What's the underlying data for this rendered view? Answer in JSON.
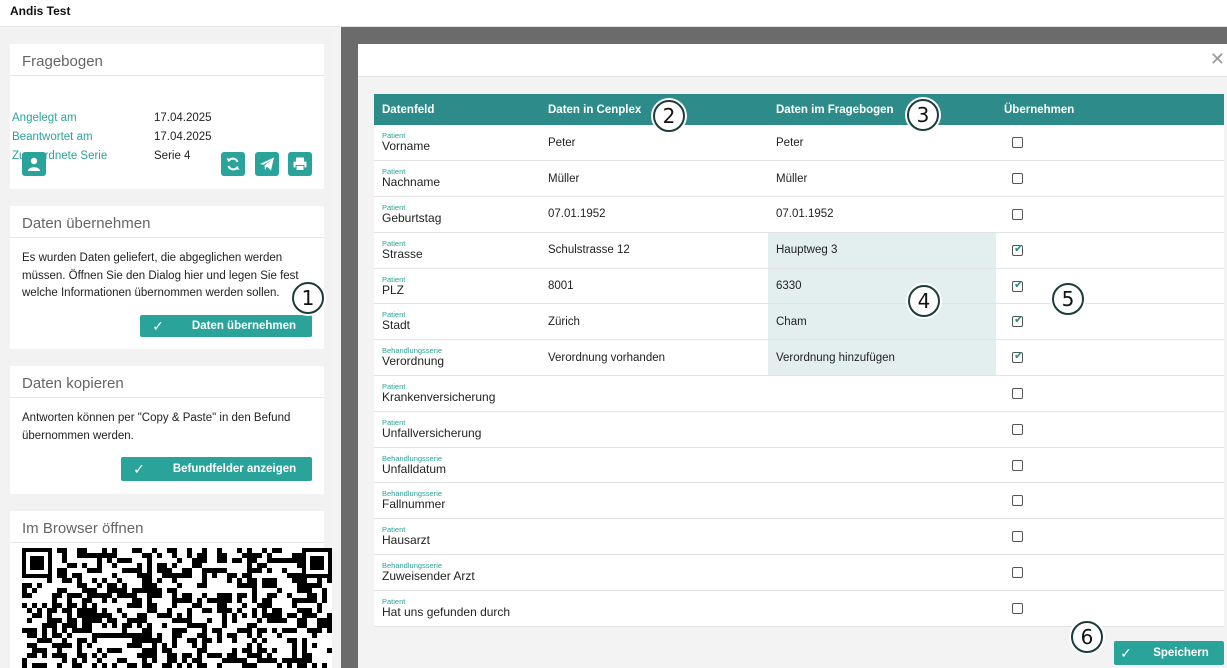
{
  "app": {
    "title": "Andis Test"
  },
  "fragebogen": {
    "title": "Fragebogen",
    "rows": [
      {
        "label": "Angelegt am",
        "value": "17.04.2025"
      },
      {
        "label": "Beantwortet am",
        "value": "17.04.2025"
      },
      {
        "label": "Zugeordnete Serie",
        "value": "Serie 4"
      }
    ],
    "icons": [
      "user-icon",
      "refresh-icon",
      "send-icon",
      "print-icon"
    ]
  },
  "daten_uebernehmen": {
    "title": "Daten übernehmen",
    "text": "Es wurden Daten geliefert, die abgeglichen werden müssen. Öffnen Sie den Dialog hier und legen Sie fest welche Informationen übernommen werden sollen.",
    "button": "Daten übernehmen"
  },
  "daten_kopieren": {
    "title": "Daten kopieren",
    "text": "Antworten können per \"Copy & Paste\" in den Befund übernommen werden.",
    "button": "Befundfelder anzeigen"
  },
  "browser": {
    "title": "Im Browser öffnen"
  },
  "badges": [
    "1",
    "2",
    "3",
    "4",
    "5",
    "6"
  ],
  "modal": {
    "close": "✕",
    "save_button": "Speichern",
    "headers": [
      "Datenfeld",
      "Daten in Cenplex",
      "Daten im Fragebogen",
      "Übernehmen"
    ],
    "rows": [
      {
        "cat": "Patient",
        "field": "Vorname",
        "cenplex": "Peter",
        "frage": "Peter",
        "checked": false,
        "diff": false
      },
      {
        "cat": "Patient",
        "field": "Nachname",
        "cenplex": "Müller",
        "frage": "Müller",
        "checked": false,
        "diff": false
      },
      {
        "cat": "Patient",
        "field": "Geburtstag",
        "cenplex": "07.01.1952",
        "frage": "07.01.1952",
        "checked": false,
        "diff": false
      },
      {
        "cat": "Patient",
        "field": "Strasse",
        "cenplex": "Schulstrasse 12",
        "frage": "Hauptweg 3",
        "checked": true,
        "diff": true
      },
      {
        "cat": "Patient",
        "field": "PLZ",
        "cenplex": "8001",
        "frage": "6330",
        "checked": true,
        "diff": true
      },
      {
        "cat": "Patient",
        "field": "Stadt",
        "cenplex": "Zürich",
        "frage": "Cham",
        "checked": true,
        "diff": true
      },
      {
        "cat": "Behandlungsserie",
        "field": "Verordnung",
        "cenplex": "Verordnung vorhanden",
        "frage": "Verordnung hinzufügen",
        "checked": true,
        "diff": true
      },
      {
        "cat": "Patient",
        "field": "Krankenversicherung",
        "cenplex": "",
        "frage": "",
        "checked": false,
        "diff": false
      },
      {
        "cat": "Patient",
        "field": "Unfallversicherung",
        "cenplex": "",
        "frage": "",
        "checked": false,
        "diff": false
      },
      {
        "cat": "Behandlungsserie",
        "field": "Unfalldatum",
        "cenplex": "",
        "frage": "",
        "checked": false,
        "diff": false
      },
      {
        "cat": "Behandlungsserie",
        "field": "Fallnummer",
        "cenplex": "",
        "frage": "",
        "checked": false,
        "diff": false
      },
      {
        "cat": "Patient",
        "field": "Hausarzt",
        "cenplex": "",
        "frage": "",
        "checked": false,
        "diff": false
      },
      {
        "cat": "Behandlungsserie",
        "field": "Zuweisender Arzt",
        "cenplex": "",
        "frage": "",
        "checked": false,
        "diff": false
      },
      {
        "cat": "Patient",
        "field": "Hat uns gefunden durch",
        "cenplex": "",
        "frage": "",
        "checked": false,
        "diff": false
      }
    ]
  }
}
